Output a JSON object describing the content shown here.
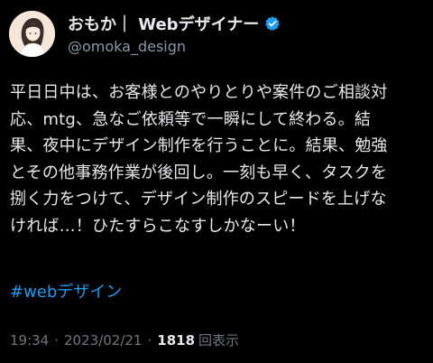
{
  "author": {
    "display_name": "おもか｜ Webデザイナー",
    "handle": "@omoka_design",
    "verified": true,
    "avatar_icon": "avatar-illustration-icon"
  },
  "tweet": {
    "text": "平日日中は、お客様とのやりとりや案件のご相談対\n応、mtg、急なご依頼等で一瞬にして終わる。結\n果、夜中にデザイン制作を行うことに。結果、勉強\nとその他事務作業が後回し。一刻も早く、タスクを\n捌く力をつけて、デザイン制作のスピードを上げな\nければ…！ひたすらこなすしかなーい！",
    "hashtag": "#webデザイン"
  },
  "meta": {
    "time": "19:34",
    "date": "2023/02/21",
    "views_count": "1818",
    "views_label": "回表示"
  },
  "colors": {
    "background": "#000000",
    "text": "#e7e9ea",
    "secondary": "#71767b",
    "accent": "#1d9bf0"
  }
}
